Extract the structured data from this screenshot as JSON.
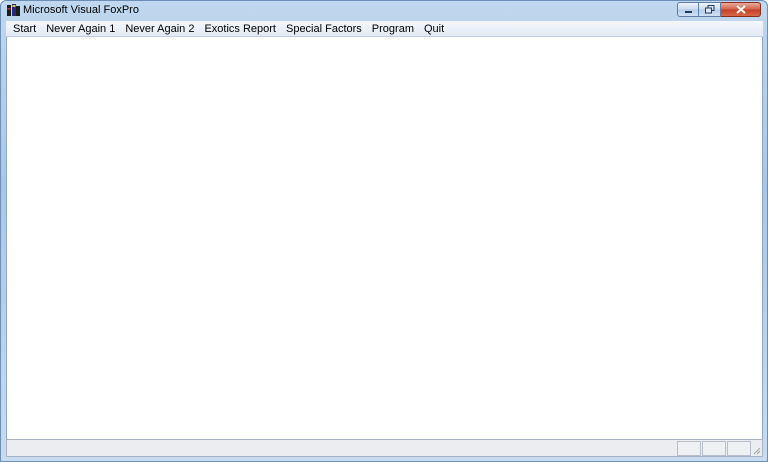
{
  "window": {
    "title": "Microsoft Visual FoxPro",
    "app_icon": "foxpro-app-icon"
  },
  "caption_buttons": {
    "minimize_icon": "minimize-icon",
    "maximize_icon": "maximize-icon",
    "close_icon": "close-icon"
  },
  "menu": {
    "items": [
      {
        "label": "Start"
      },
      {
        "label": "Never Again 1"
      },
      {
        "label": "Never Again 2"
      },
      {
        "label": "Exotics Report"
      },
      {
        "label": "Special Factors"
      },
      {
        "label": "Program"
      },
      {
        "label": "Quit"
      }
    ]
  },
  "statusbar": {
    "panels": [
      "",
      "",
      ""
    ]
  },
  "colors": {
    "frame": "#a9c6e6",
    "close_button": "#c23f24",
    "client_background": "#ffffff"
  }
}
